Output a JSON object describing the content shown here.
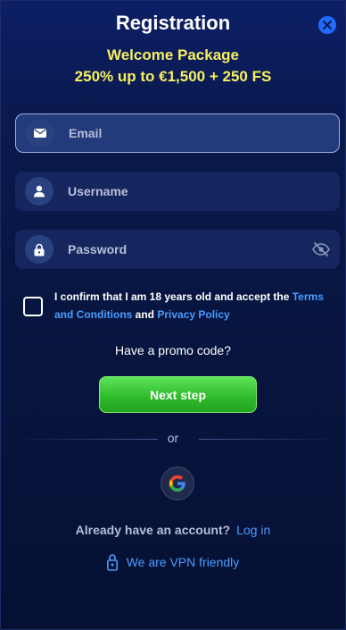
{
  "header": {
    "title": "Registration",
    "promo_line1": "Welcome Package",
    "promo_line2": "250% up to €1,500 + 250 FS"
  },
  "form": {
    "email_placeholder": "Email",
    "username_placeholder": "Username",
    "password_placeholder": "Password",
    "confirm_text_before": "I confirm that I am 18 years old and accept the ",
    "terms_link": "Terms and Conditions",
    "confirm_and": " and ",
    "privacy_link": "Privacy Policy",
    "promo_code_label": "Have a promo code?",
    "next_button": "Next step",
    "or_label": "or"
  },
  "footer": {
    "account_question": "Already have an account?",
    "login_link": "Log in",
    "vpn_text": "We are VPN friendly"
  },
  "icons": {
    "close": "close-icon",
    "email": "envelope-icon",
    "username": "user-icon",
    "password": "lock-icon",
    "toggle_password": "eye-off-icon",
    "google": "google-icon",
    "vpn": "lock-icon"
  },
  "colors": {
    "accent_yellow": "#f6ef5e",
    "link_blue": "#4a9dff",
    "button_green": "#2fbd2c",
    "close_blue": "#1f6bff"
  }
}
